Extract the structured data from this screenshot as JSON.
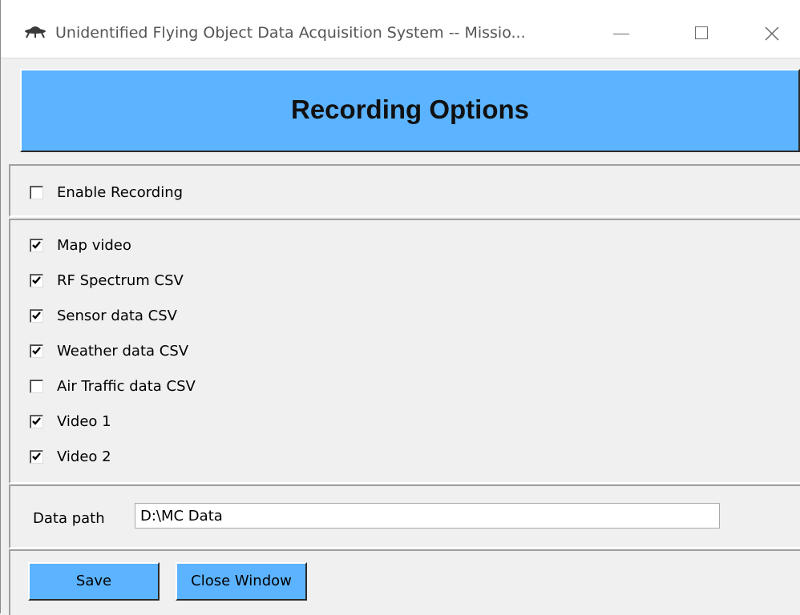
{
  "window": {
    "title": "Unidentified Flying Object Data Acquisition System -- Missio...",
    "icon": "ufo-icon",
    "controls": [
      "minimize",
      "maximize",
      "close"
    ]
  },
  "banner": {
    "title": "Recording Options",
    "color": "#5cb3ff"
  },
  "enable_recording": {
    "label": "Enable Recording",
    "checked": false
  },
  "options": [
    {
      "label": "Map video",
      "checked": true
    },
    {
      "label": "RF Spectrum CSV",
      "checked": true
    },
    {
      "label": "Sensor data CSV",
      "checked": true
    },
    {
      "label": "Weather data CSV",
      "checked": true
    },
    {
      "label": "Air Traffic data CSV",
      "checked": false
    },
    {
      "label": "Video 1",
      "checked": true
    },
    {
      "label": "Video 2",
      "checked": true
    }
  ],
  "data_path": {
    "label": "Data path",
    "value": "D:\\MC Data"
  },
  "buttons": {
    "save_label": "Save",
    "close_label": "Close Window"
  }
}
